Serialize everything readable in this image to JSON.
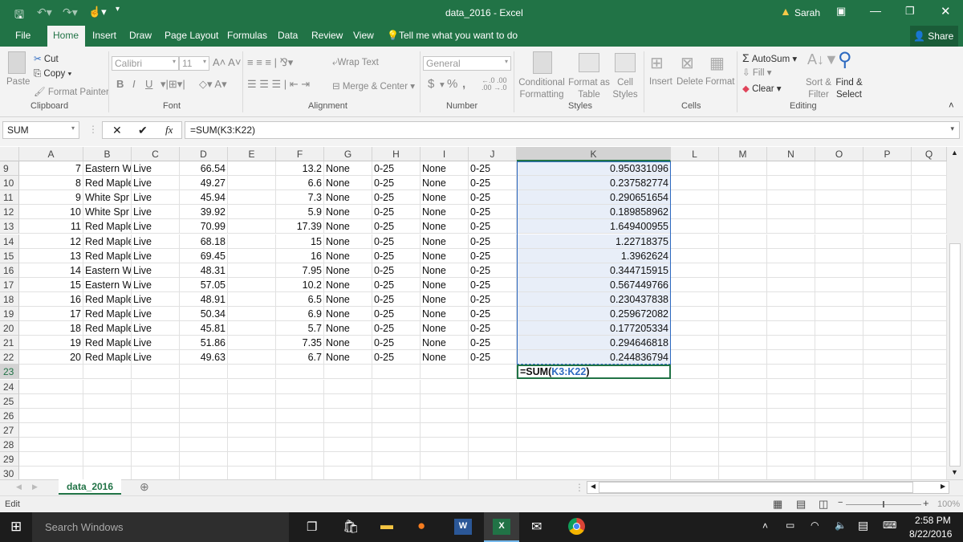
{
  "window": {
    "title": "data_2016 - Excel",
    "user": "Sarah",
    "share": "Share"
  },
  "qat": {
    "icons": [
      "save-icon",
      "undo-icon",
      "redo-icon",
      "touch-mode-icon",
      "customize-icon"
    ]
  },
  "menu_tabs": [
    "File",
    "Home",
    "Insert",
    "Draw",
    "Page Layout",
    "Formulas",
    "Data",
    "Review",
    "View"
  ],
  "active_tab": "Home",
  "tell_me": "Tell me what you want to do",
  "ribbon": {
    "clipboard": {
      "paste": "Paste",
      "cut": "Cut",
      "copy": "Copy",
      "format_painter": "Format Painter",
      "label": "Clipboard"
    },
    "font": {
      "name": "Calibri",
      "size": "11",
      "label": "Font",
      "bold": "B",
      "italic": "I",
      "underline": "U"
    },
    "alignment": {
      "wrap": "Wrap Text",
      "merge": "Merge & Center",
      "label": "Alignment"
    },
    "number": {
      "format": "General",
      "label": "Number",
      "currency": "$",
      "percent": "%",
      "comma": ","
    },
    "styles": {
      "conditional": "Conditional Formatting",
      "format_table": "Format as Table",
      "cell_styles": "Cell Styles",
      "label": "Styles"
    },
    "cells": {
      "insert": "Insert",
      "delete": "Delete",
      "format": "Format",
      "label": "Cells"
    },
    "editing": {
      "autosum": "AutoSum",
      "fill": "Fill",
      "clear": "Clear",
      "sort": "Sort & Filter",
      "find": "Find & Select",
      "label": "Editing"
    }
  },
  "formula_bar": {
    "name_box": "SUM",
    "fx": "fx",
    "formula": "=SUM(K3:K22)"
  },
  "columns": [
    "A",
    "B",
    "C",
    "D",
    "E",
    "F",
    "G",
    "H",
    "I",
    "J",
    "K",
    "L",
    "M",
    "N",
    "O",
    "P",
    "Q"
  ],
  "rows": [
    {
      "n": "9",
      "A": "7",
      "B": "Eastern W",
      "C": "Live",
      "D": "66.54",
      "F": "13.2",
      "G": "None",
      "H": "0-25",
      "I": "None",
      "J": "0-25",
      "K": "0.950331096"
    },
    {
      "n": "10",
      "A": "8",
      "B": "Red Maple",
      "C": "Live",
      "D": "49.27",
      "F": "6.6",
      "G": "None",
      "H": "0-25",
      "I": "None",
      "J": "0-25",
      "K": "0.237582774"
    },
    {
      "n": "11",
      "A": "9",
      "B": "White Spr",
      "C": "Live",
      "D": "45.94",
      "F": "7.3",
      "G": "None",
      "H": "0-25",
      "I": "None",
      "J": "0-25",
      "K": "0.290651654"
    },
    {
      "n": "12",
      "A": "10",
      "B": "White Spr",
      "C": "Live",
      "D": "39.92",
      "F": "5.9",
      "G": "None",
      "H": "0-25",
      "I": "None",
      "J": "0-25",
      "K": "0.189858962"
    },
    {
      "n": "13",
      "A": "11",
      "B": "Red Maple",
      "C": "Live",
      "D": "70.99",
      "F": "17.39",
      "G": "None",
      "H": "0-25",
      "I": "None",
      "J": "0-25",
      "K": "1.649400955"
    },
    {
      "n": "14",
      "A": "12",
      "B": "Red Maple",
      "C": "Live",
      "D": "68.18",
      "F": "15",
      "G": "None",
      "H": "0-25",
      "I": "None",
      "J": "0-25",
      "K": "1.22718375"
    },
    {
      "n": "15",
      "A": "13",
      "B": "Red Maple",
      "C": "Live",
      "D": "69.45",
      "F": "16",
      "G": "None",
      "H": "0-25",
      "I": "None",
      "J": "0-25",
      "K": "1.3962624"
    },
    {
      "n": "16",
      "A": "14",
      "B": "Eastern W",
      "C": "Live",
      "D": "48.31",
      "F": "7.95",
      "G": "None",
      "H": "0-25",
      "I": "None",
      "J": "0-25",
      "K": "0.344715915"
    },
    {
      "n": "17",
      "A": "15",
      "B": "Eastern W",
      "C": "Live",
      "D": "57.05",
      "F": "10.2",
      "G": "None",
      "H": "0-25",
      "I": "None",
      "J": "0-25",
      "K": "0.567449766"
    },
    {
      "n": "18",
      "A": "16",
      "B": "Red Maple",
      "C": "Live",
      "D": "48.91",
      "F": "6.5",
      "G": "None",
      "H": "0-25",
      "I": "None",
      "J": "0-25",
      "K": "0.230437838"
    },
    {
      "n": "19",
      "A": "17",
      "B": "Red Maple",
      "C": "Live",
      "D": "50.34",
      "F": "6.9",
      "G": "None",
      "H": "0-25",
      "I": "None",
      "J": "0-25",
      "K": "0.259672082"
    },
    {
      "n": "20",
      "A": "18",
      "B": "Red Maple",
      "C": "Live",
      "D": "45.81",
      "F": "5.7",
      "G": "None",
      "H": "0-25",
      "I": "None",
      "J": "0-25",
      "K": "0.177205334"
    },
    {
      "n": "21",
      "A": "19",
      "B": "Red Maple",
      "C": "Live",
      "D": "51.86",
      "F": "7.35",
      "G": "None",
      "H": "0-25",
      "I": "None",
      "J": "0-25",
      "K": "0.294646818"
    },
    {
      "n": "22",
      "A": "20",
      "B": "Red Maple",
      "C": "Live",
      "D": "49.63",
      "F": "6.7",
      "G": "None",
      "H": "0-25",
      "I": "None",
      "J": "0-25",
      "K": "0.244836794"
    },
    {
      "n": "23",
      "K": "=SUM(K3:K22)"
    },
    {
      "n": "24"
    },
    {
      "n": "25"
    },
    {
      "n": "26"
    },
    {
      "n": "27"
    },
    {
      "n": "28"
    },
    {
      "n": "29"
    },
    {
      "n": "30"
    }
  ],
  "active_cell": {
    "formula_prefix": "=SUM(",
    "formula_ref": "K3:K22",
    "formula_suffix": ")"
  },
  "sheet_tabs": [
    "data_2016"
  ],
  "status": {
    "mode": "Edit",
    "zoom": "100%"
  },
  "taskbar": {
    "search": "Search Windows",
    "time": "2:58 PM",
    "date": "8/22/2016"
  },
  "colors": {
    "excel_green": "#217346",
    "selection": "#e8eef8",
    "ref_blue": "#2e6ac0"
  }
}
